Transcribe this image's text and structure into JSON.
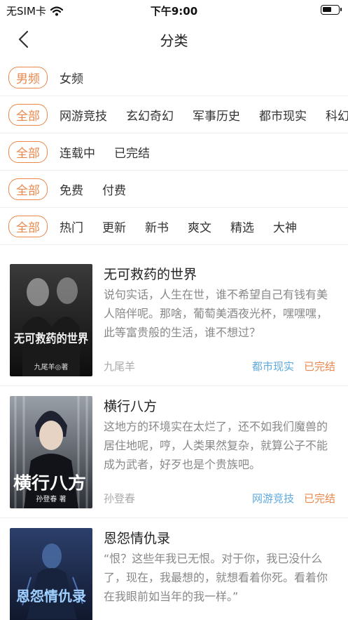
{
  "status_bar": {
    "carrier": "无SIM卡",
    "time": "下午9:00",
    "battery_level": 0.62
  },
  "nav": {
    "title": "分类"
  },
  "filters": {
    "gender": [
      "男频",
      "女频"
    ],
    "genre": [
      "全部",
      "网游竞技",
      "玄幻奇幻",
      "军事历史",
      "都市现实",
      "科幻"
    ],
    "status": [
      "全部",
      "连载中",
      "已完结"
    ],
    "price": [
      "全部",
      "免费",
      "付费"
    ],
    "sort": [
      "全部",
      "热门",
      "更新",
      "新书",
      "爽文",
      "精选",
      "大神"
    ]
  },
  "books": [
    {
      "title": "无可救药的世界",
      "description": "说句实话，人生在世，谁不希望自己有钱有美人陪伴呢。那啥，葡萄美酒夜光杯，嘿嘿嘿，此等富贵般的生活，谁不想过？",
      "author": "九尾羊",
      "category": "都市现实",
      "status": "已完结",
      "cover_title": "无可救药的世界",
      "cover_author": "九尾羊◎著",
      "cover_colors": [
        "#2a2a2a",
        "#0d0d0d"
      ]
    },
    {
      "title": "横行八方",
      "description": "这地方的环境实在太烂了，还不如我们魔兽的居住地呢，哼，人类果然复杂，就算公子不能成为武者，好歹也是个贵族吧。",
      "author": "孙登春",
      "category": "网游竞技",
      "status": "已完结",
      "cover_title": "横行八方",
      "cover_author": "孙登春 著",
      "cover_colors": [
        "#8a8f97",
        "#2b2f36"
      ]
    },
    {
      "title": "恩怨情仇录",
      "description": "“恨？这些年我已无恨。对于你，我已没什么了，现在，我最想的，就想看着你死。看着你在我眼前如当年的我一样。”",
      "author": "",
      "category": "",
      "status": "",
      "cover_title": "恩怨情仇录",
      "cover_author": "",
      "cover_colors": [
        "#1c2a4a",
        "#0a0f1f"
      ]
    }
  ]
}
